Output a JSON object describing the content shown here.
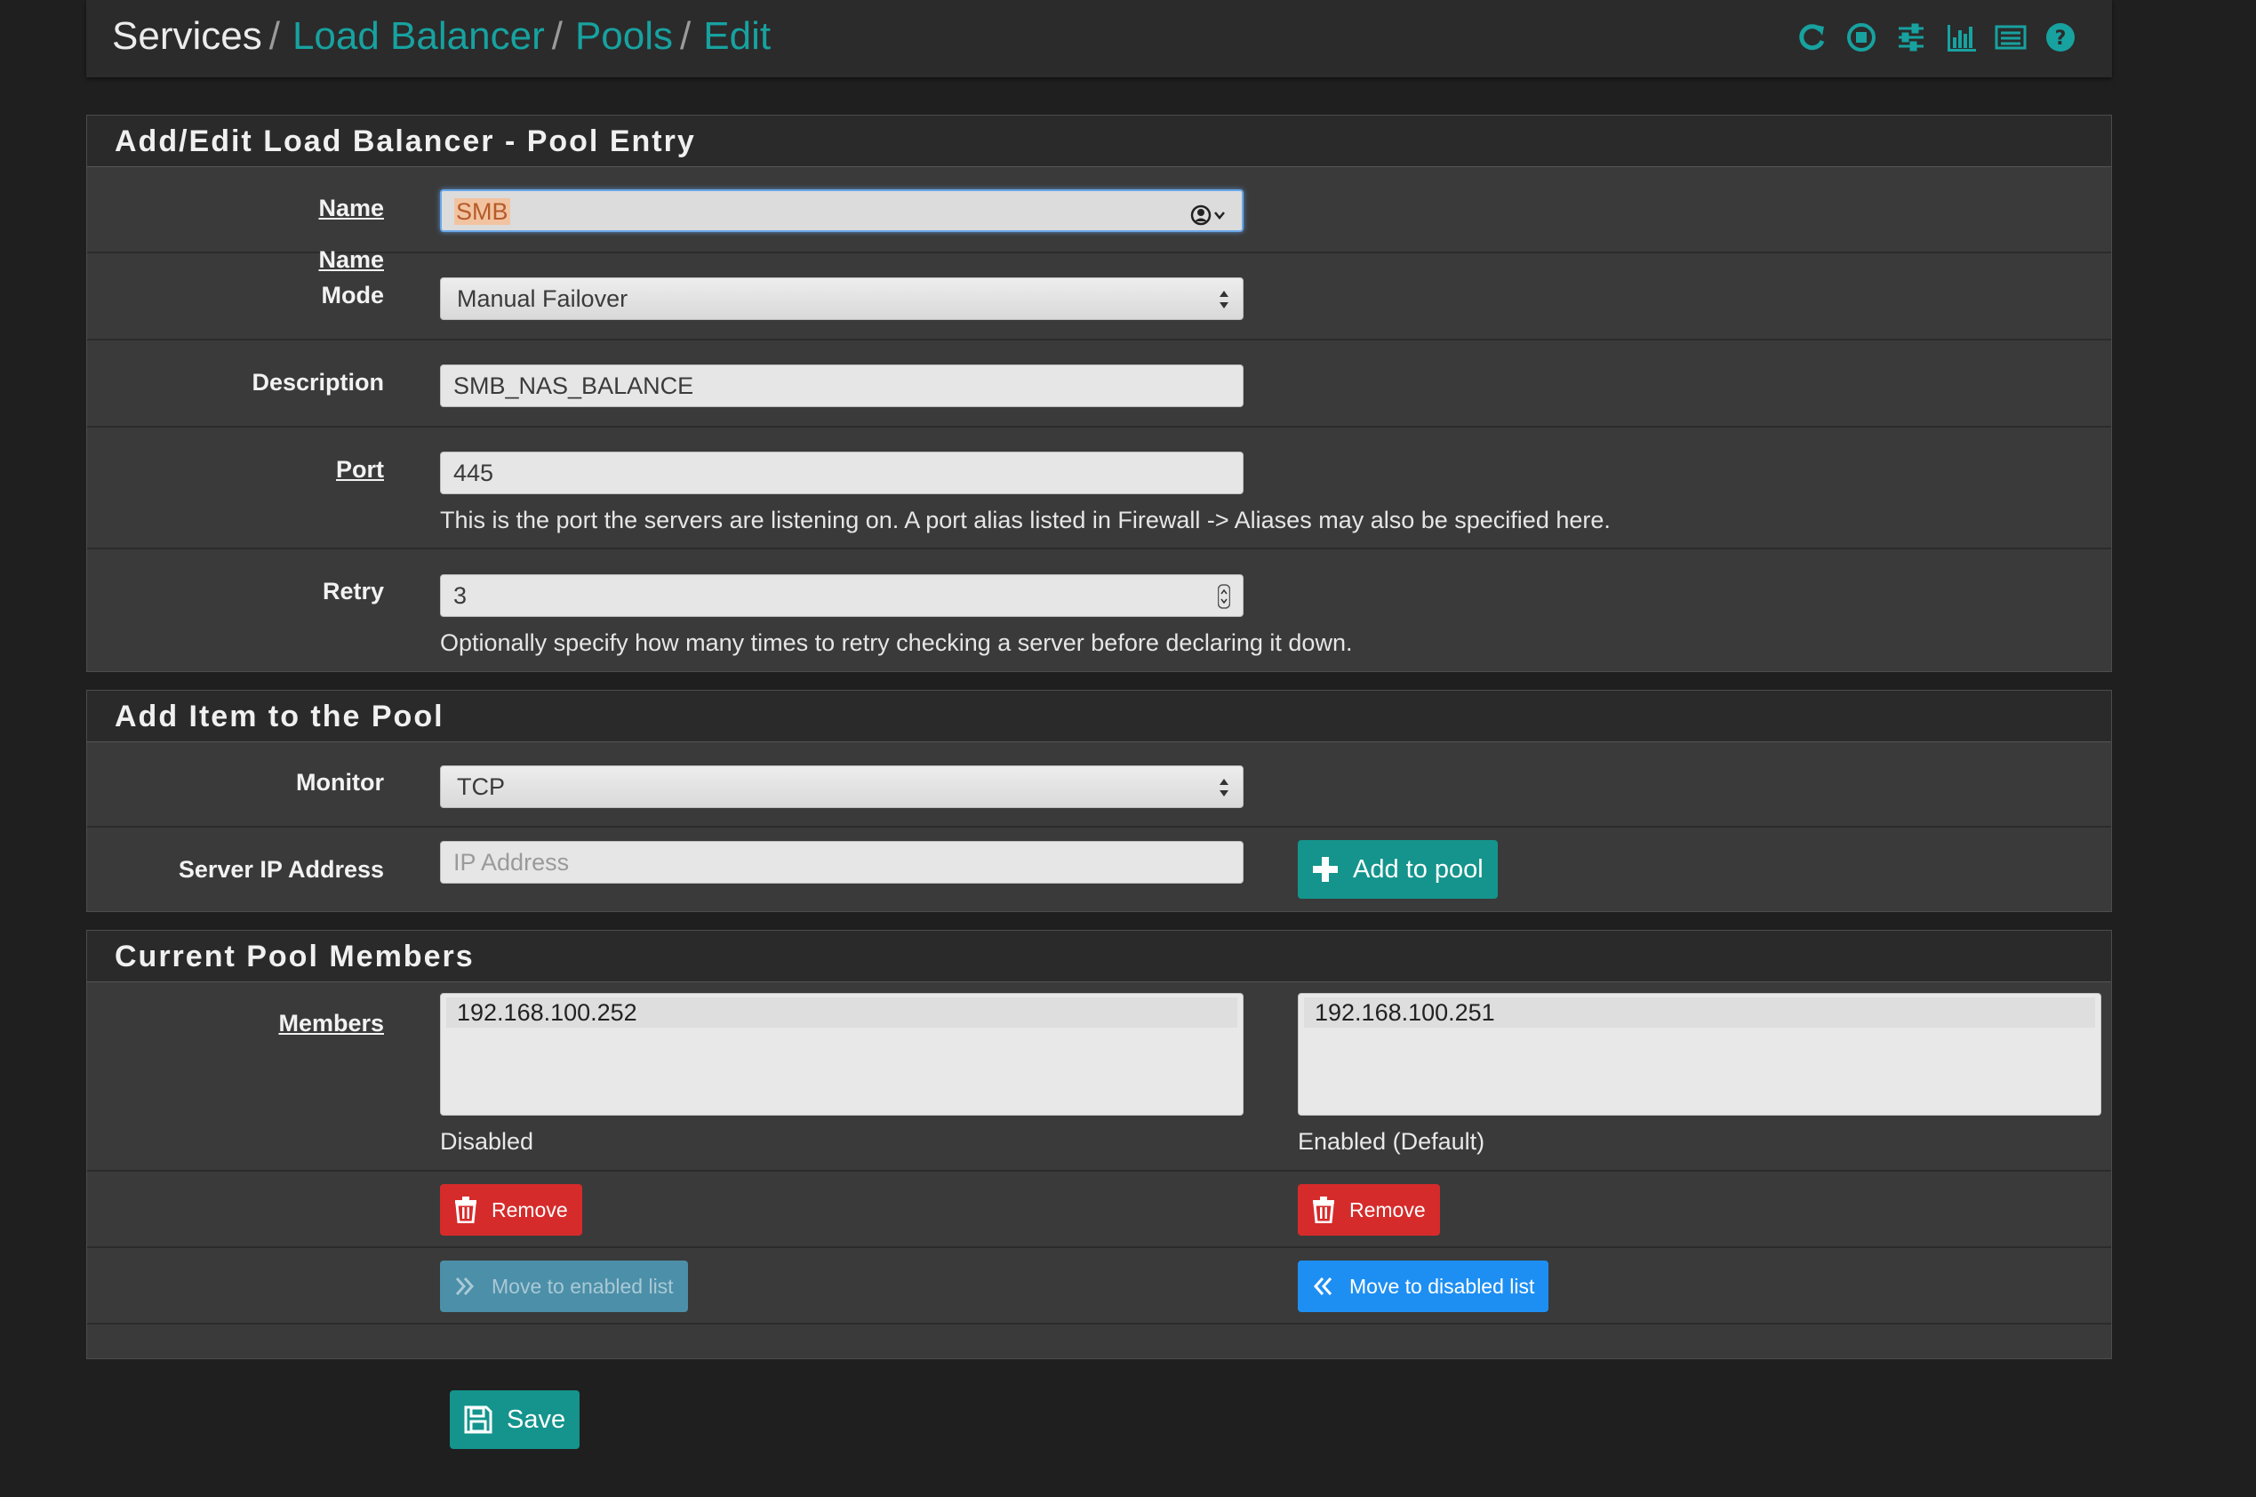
{
  "breadcrumb": {
    "items": [
      "Services",
      "Load Balancer",
      "Pools",
      "Edit"
    ],
    "separator": "/"
  },
  "toolbar": {
    "icons": [
      "restart-icon",
      "stop-icon",
      "settings-sliders-icon",
      "bar-chart-icon",
      "log-list-icon",
      "help-icon"
    ]
  },
  "pool_entry": {
    "title": "Add/Edit Load Balancer - Pool Entry",
    "name": {
      "label": "Name",
      "value": "SMB"
    },
    "mode": {
      "label": "Mode",
      "value": "Manual Failover"
    },
    "description": {
      "label": "Description",
      "value": "SMB_NAS_BALANCE"
    },
    "port": {
      "label": "Port",
      "value": "445",
      "help": "This is the port the servers are listening on. A port alias listed in Firewall -> Aliases may also be specified here."
    },
    "retry": {
      "label": "Retry",
      "value": "3",
      "help": "Optionally specify how many times to retry checking a server before declaring it down."
    }
  },
  "add_item": {
    "title": "Add Item to the Pool",
    "monitor": {
      "label": "Monitor",
      "value": "TCP"
    },
    "server_ip": {
      "label": "Server IP Address",
      "placeholder": "IP Address"
    },
    "add_button": "Add to pool"
  },
  "members": {
    "title": "Current Pool Members",
    "label": "Members",
    "disabled_list": {
      "items": [
        "192.168.100.252"
      ],
      "caption": "Disabled",
      "remove": "Remove",
      "move": "Move to enabled list"
    },
    "enabled_list": {
      "items": [
        "192.168.100.251"
      ],
      "caption": "Enabled (Default)",
      "remove": "Remove",
      "move": "Move to disabled list"
    }
  },
  "save_button": "Save",
  "colors": {
    "accent": "#17a2a0",
    "danger": "#d62b2b",
    "primary": "#1e8ff2",
    "background": "#1f1f1f"
  }
}
